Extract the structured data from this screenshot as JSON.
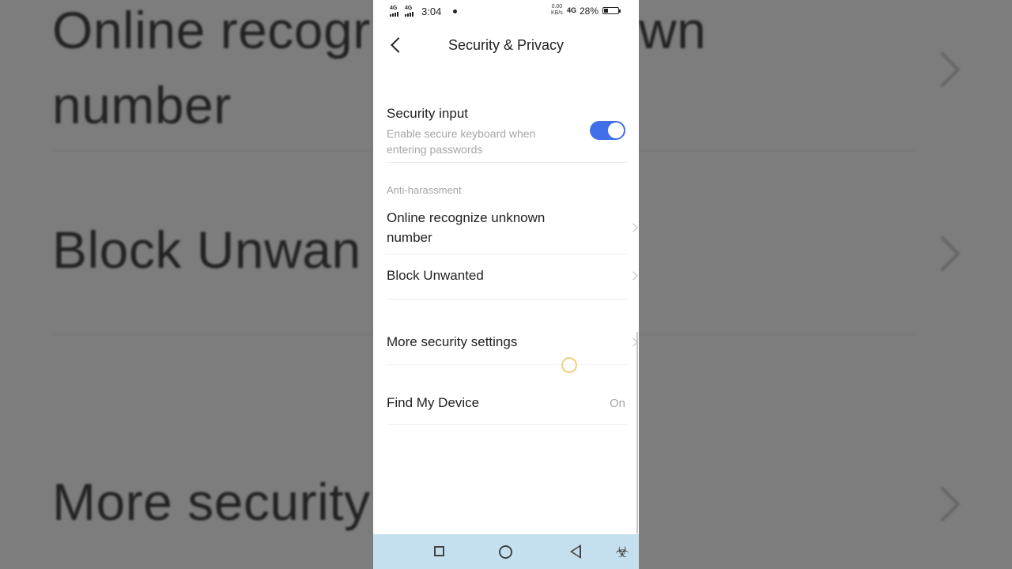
{
  "background": {
    "line1": "Online recogr",
    "line1_right": "wn",
    "line2": "number",
    "line3": "Block Unwan",
    "line4": "More security"
  },
  "status_bar": {
    "signal1": "4G",
    "signal2": "4G",
    "time": "3:04",
    "speed_value": "0.00",
    "speed_unit": "KB/s",
    "network": "4G",
    "battery": "28%",
    "battery_level": 0.28
  },
  "header": {
    "title": "Security & Privacy"
  },
  "settings": {
    "security_input": {
      "title": "Security input",
      "subtitle": "Enable secure keyboard when entering passwords",
      "enabled": true
    },
    "section_anti_harassment": "Anti-harassment",
    "online_recognize": "Online recognize unknown number",
    "block_unwanted": "Block Unwanted",
    "more_security": "More security settings",
    "find_my_device": {
      "title": "Find My Device",
      "value": "On"
    }
  },
  "colors": {
    "accent": "#3f6ee8",
    "navbar": "#c4e0ee"
  },
  "icons": [
    "back-icon",
    "chevron-right-icon",
    "recent-apps-icon",
    "home-icon",
    "nav-back-icon",
    "accessibility-icon"
  ]
}
